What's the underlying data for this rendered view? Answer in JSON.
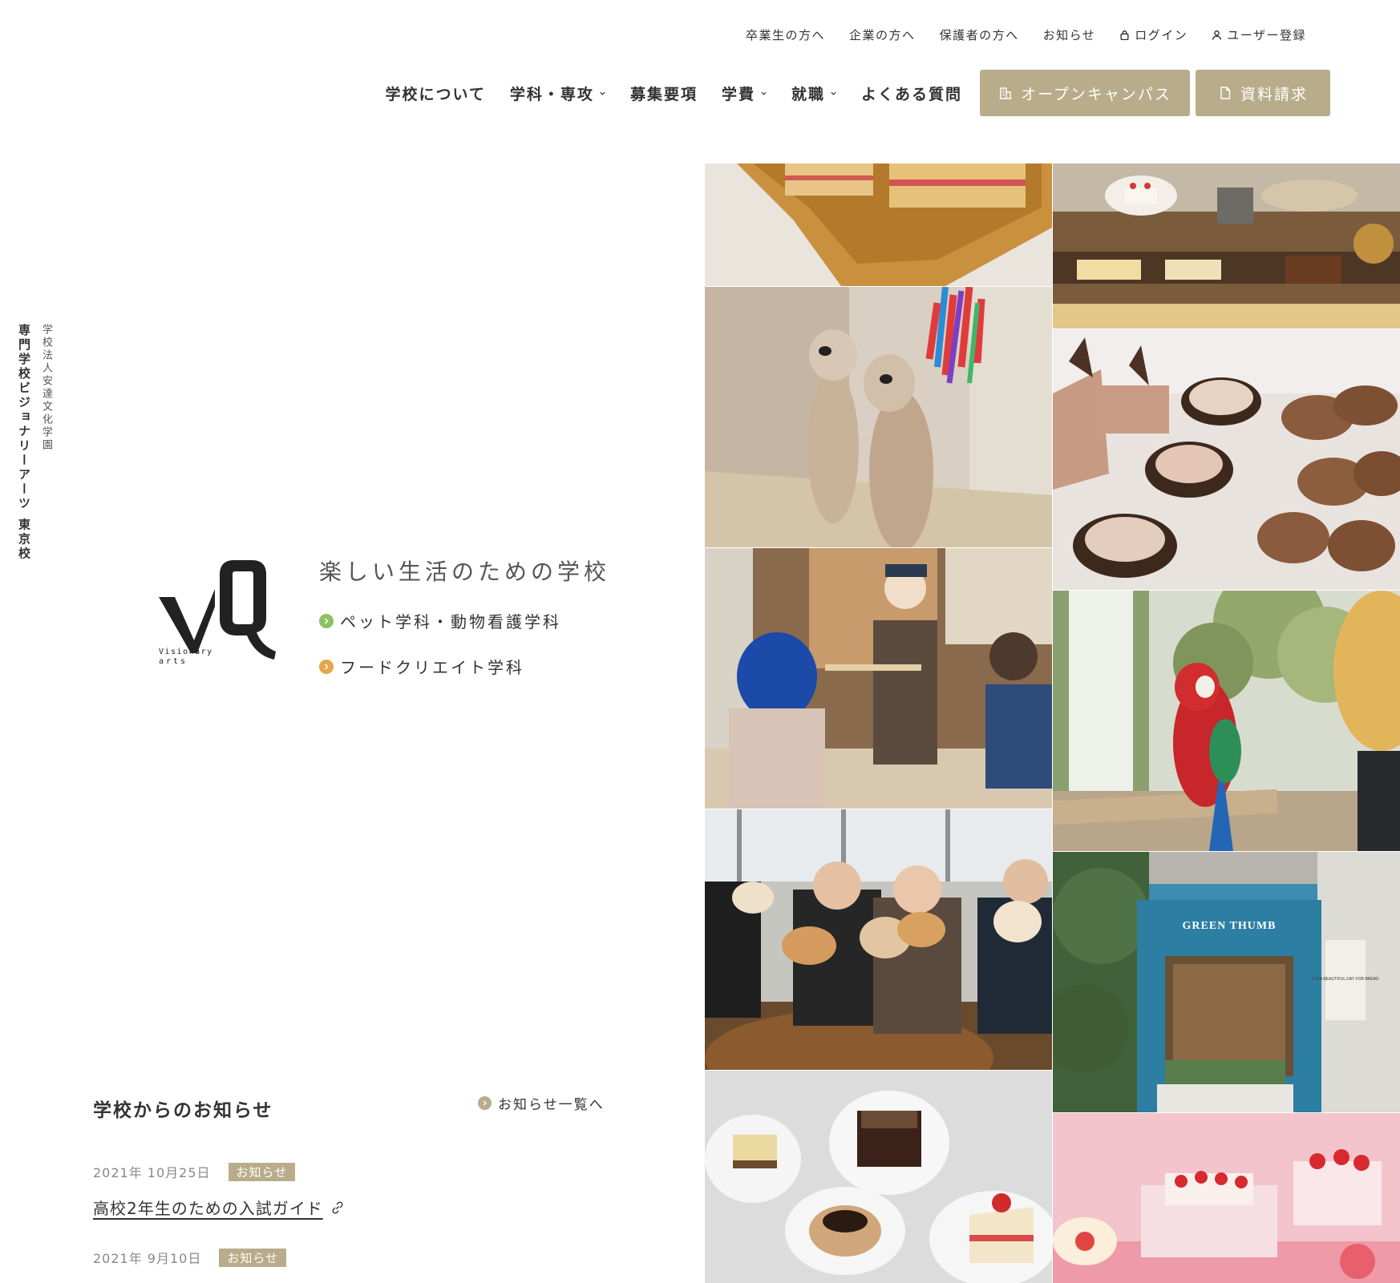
{
  "util_nav": [
    {
      "label": "卒業生の方へ",
      "icon": ""
    },
    {
      "label": "企業の方へ",
      "icon": ""
    },
    {
      "label": "保護者の方へ",
      "icon": ""
    },
    {
      "label": "お知らせ",
      "icon": ""
    },
    {
      "label": "ログイン",
      "icon": "lock-icon"
    },
    {
      "label": "ユーザー登録",
      "icon": "user-icon"
    }
  ],
  "main_nav": [
    {
      "label": "学校について",
      "dropdown": false
    },
    {
      "label": "学科・専攻",
      "dropdown": true
    },
    {
      "label": "募集要項",
      "dropdown": false
    },
    {
      "label": "学費",
      "dropdown": true
    },
    {
      "label": "就職",
      "dropdown": true
    },
    {
      "label": "よくある質問",
      "dropdown": false
    }
  ],
  "cta": {
    "open_campus": "オープンキャンパス",
    "request_docs": "資料請求"
  },
  "school": {
    "name_vertical": "専門学校ビジョナリーアーツ 東京校",
    "corp_vertical": "学校法人安達文化学園",
    "logo_text_1": "Visionary",
    "logo_text_2": "arts"
  },
  "hero": {
    "tagline": "楽しい生活のための学校",
    "departments": [
      {
        "label": "ペット学科・動物看護学科",
        "color": "#8cc063"
      },
      {
        "label": "フードクリエイト学科",
        "color": "#e8a64c"
      }
    ]
  },
  "news": {
    "title": "学校からのお知らせ",
    "more": "お知らせ一覧へ",
    "items": [
      {
        "date": "2021年 10月25日",
        "tag": "お知らせ",
        "title": "高校2年生のための入試ガイド"
      },
      {
        "date": "2021年 9月10日",
        "tag": "お知らせ",
        "title": ""
      }
    ]
  },
  "photos": {
    "shop_sign": "GREEN THUMB",
    "board_text": "IT'S A BEAUTIFUL DAY FOR BREAD"
  },
  "colors": {
    "accent": "#b8ac8a",
    "pet_green": "#8cc063",
    "food_orange": "#e8a64c",
    "text": "#333333"
  }
}
